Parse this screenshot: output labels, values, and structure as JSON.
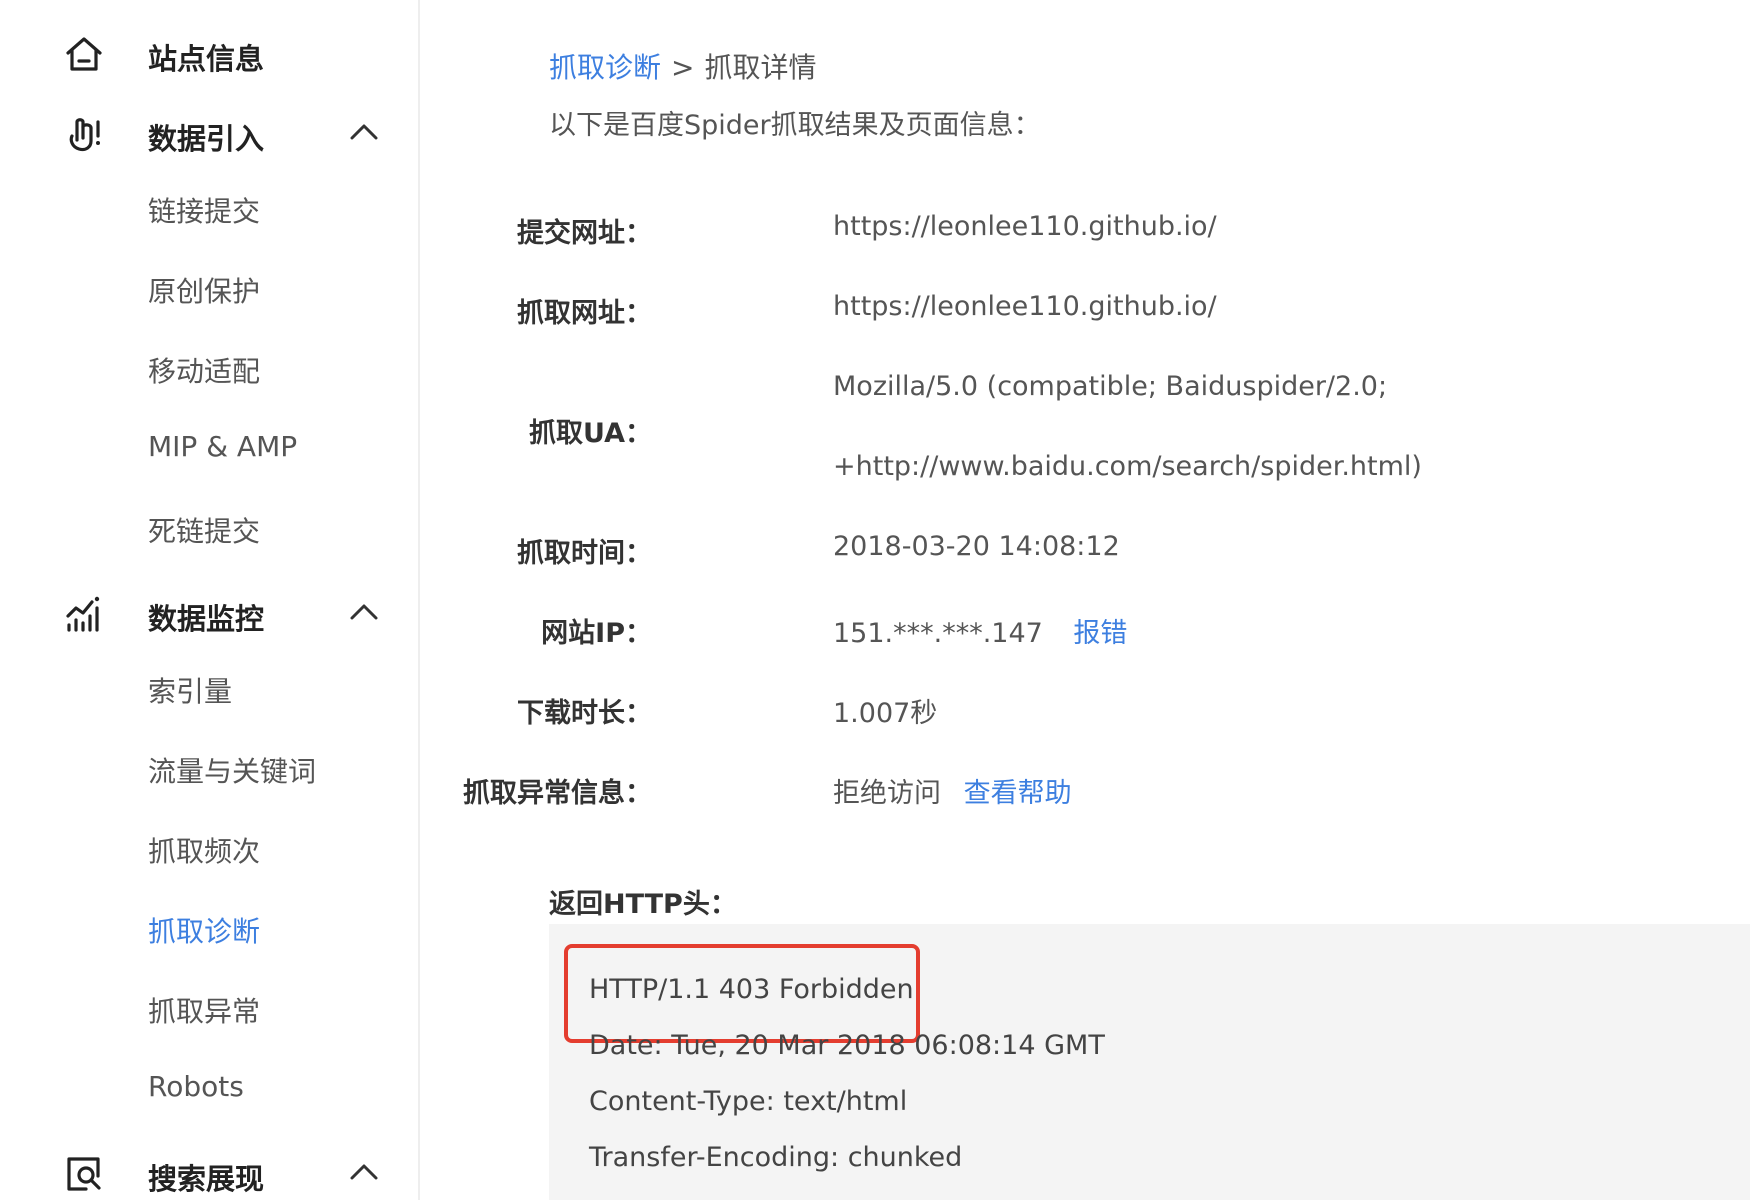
{
  "sidebar": {
    "groups": [
      {
        "label": "站点信息",
        "icon": "home-icon",
        "expandable": false
      },
      {
        "label": "数据引入",
        "icon": "hand-upload-icon",
        "expandable": true,
        "items": [
          "链接提交",
          "原创保护",
          "移动适配",
          "MIP & AMP",
          "死链提交"
        ]
      },
      {
        "label": "数据监控",
        "icon": "chart-monitor-icon",
        "expandable": true,
        "items": [
          "索引量",
          "流量与关键词",
          "抓取频次",
          "抓取诊断",
          "抓取异常",
          "Robots"
        ]
      },
      {
        "label": "搜索展现",
        "icon": "search-display-icon",
        "expandable": true
      }
    ],
    "active_item": "抓取诊断"
  },
  "breadcrumb": {
    "parent": "抓取诊断",
    "separator": ">",
    "current": "抓取详情"
  },
  "intro": "以下是百度Spider抓取结果及页面信息：",
  "details": {
    "submit_url_label": "提交网址：",
    "submit_url": "https://leonlee110.github.io/",
    "crawl_url_label": "抓取网址：",
    "crawl_url": "https://leonlee110.github.io/",
    "ua_label": "抓取UA：",
    "ua_line1": "Mozilla/5.0 (compatible; Baiduspider/2.0;",
    "ua_line2": "+http://www.baidu.com/search/spider.html)",
    "time_label": "抓取时间：",
    "time": "2018-03-20 14:08:12",
    "ip_label": "网站IP：",
    "ip": "151.***.***.147",
    "ip_report_link": "报错",
    "download_label": "下载时长：",
    "download": "1.007秒",
    "error_label": "抓取异常信息：",
    "error": "拒绝访问",
    "error_help_link": "查看帮助"
  },
  "http_headers": {
    "title": "返回HTTP头：",
    "lines": [
      "HTTP/1.1 403 Forbidden",
      "Date: Tue, 20 Mar 2018 06:08:14 GMT",
      "Content-Type: text/html",
      "Transfer-Encoding: chunked"
    ],
    "highlight_color": "#e43d2f"
  },
  "colors": {
    "link": "#3d7fe0",
    "active": "#3d7fe0"
  }
}
